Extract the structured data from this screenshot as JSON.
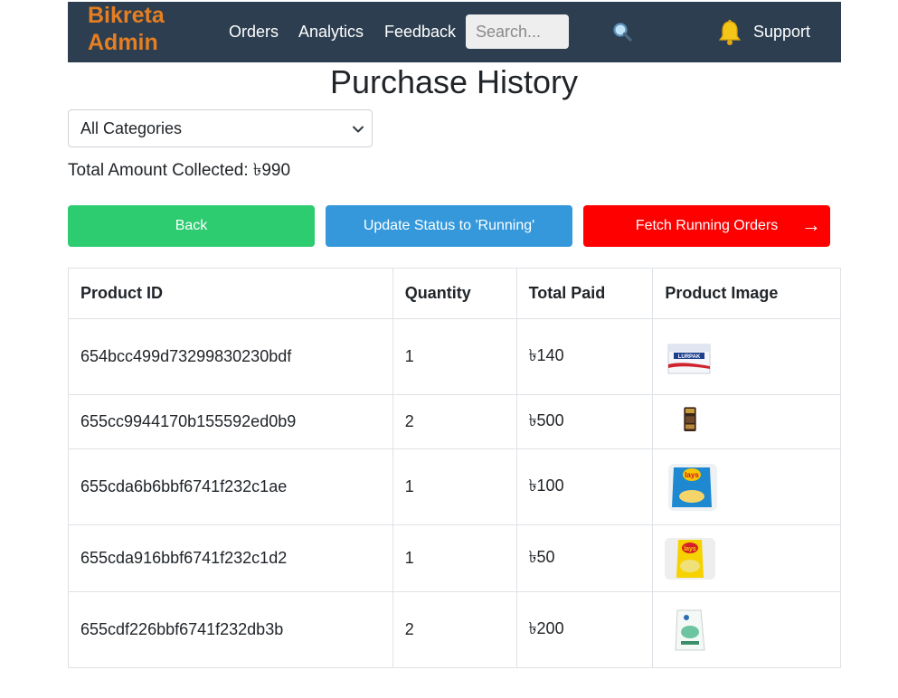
{
  "navbar": {
    "brand_line1": "Bikreta",
    "brand_line2": "Admin",
    "links": [
      "Orders",
      "Analytics",
      "Feedback"
    ],
    "search_placeholder": "Search...",
    "support_label": "Support",
    "icons": [
      "search-icon",
      "bell-icon"
    ],
    "brand_color": "#e67e22",
    "bg_color": "#2c3e50"
  },
  "page": {
    "title": "Purchase History",
    "category_selected": "All Categories",
    "total_label": "Total Amount Collected: ৳990"
  },
  "buttons": {
    "back": "Back",
    "update": "Update Status to 'Running'",
    "fetch": "Fetch Running Orders",
    "fetch_arrow": "→"
  },
  "table": {
    "headers": [
      "Product ID",
      "Quantity",
      "Total Paid",
      "Product Image"
    ],
    "rows": [
      {
        "id": "654bcc499d73299830230bdf",
        "qty": "1",
        "paid": "৳140",
        "image": "butter-pack"
      },
      {
        "id": "655cc9944170b155592ed0b9",
        "qty": "2",
        "paid": "৳500",
        "image": "coffee-bag"
      },
      {
        "id": "655cda6b6bbf6741f232c1ae",
        "qty": "1",
        "paid": "৳100",
        "image": "chips-blue-bag"
      },
      {
        "id": "655cda916bbf6741f232c1d2",
        "qty": "1",
        "paid": "৳50",
        "image": "chips-yellow-bag"
      },
      {
        "id": "655cdf226bbf6741f232db3b",
        "qty": "2",
        "paid": "৳200",
        "image": "milk-pouch"
      }
    ]
  },
  "colors": {
    "green": "#2ecc71",
    "blue": "#3498db",
    "red": "#ff0000"
  }
}
